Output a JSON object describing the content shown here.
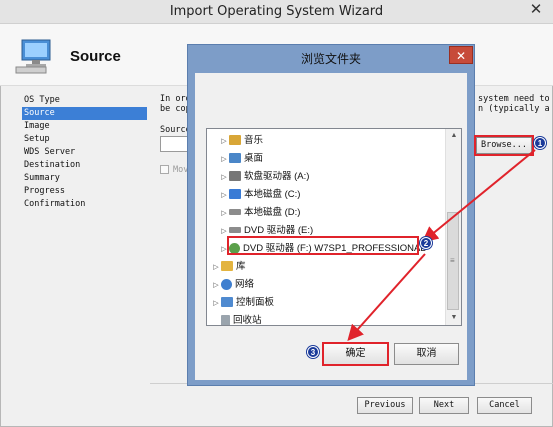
{
  "window": {
    "title": "Import Operating System Wizard",
    "close_glyph": "✕"
  },
  "header": {
    "title": "Source"
  },
  "nav": {
    "items": [
      {
        "label": "OS Type"
      },
      {
        "label": "Source"
      },
      {
        "label": "Image"
      },
      {
        "label": "Setup"
      },
      {
        "label": "WDS Server"
      },
      {
        "label": "Destination"
      },
      {
        "label": "Summary"
      },
      {
        "label": "Progress"
      },
      {
        "label": "Confirmation"
      }
    ],
    "selected_index": 1
  },
  "main": {
    "desc_line1_left": "In ord",
    "desc_line1_right": "system need to",
    "desc_line2_left": "be cop",
    "desc_line2_right": "n (typically a",
    "source_label": "Source",
    "checkbox_label": "Mov",
    "browse_label": "Browse..."
  },
  "footer": {
    "previous": "Previous",
    "next": "Next",
    "cancel": "Cancel"
  },
  "dialog": {
    "title": "浏览文件夹",
    "close_glyph": "✕",
    "ok_label": "确定",
    "cancel_label": "取消",
    "tree": [
      {
        "label": "音乐",
        "icon": "music-folder-icon",
        "color": "#d8a637",
        "level": 1
      },
      {
        "label": "桌面",
        "icon": "desktop-folder-icon",
        "color": "#4a86c8",
        "level": 1
      },
      {
        "label": "软盘驱动器 (A:)",
        "icon": "floppy-drive-icon",
        "color": "#777777",
        "level": 1
      },
      {
        "label": "本地磁盘 (C:)",
        "icon": "windows-drive-icon",
        "color": "#3a7bd5",
        "level": 1
      },
      {
        "label": "本地磁盘 (D:)",
        "icon": "disk-drive-icon",
        "color": "#8c8c8c",
        "level": 1
      },
      {
        "label": "DVD 驱动器 (E:)",
        "icon": "dvd-drive-icon",
        "color": "#8c8c8c",
        "level": 1
      },
      {
        "label": "DVD 驱动器 (F:) W7SP1_PROFESSIONAL",
        "icon": "dvd-disc-icon",
        "color": "#5aa04a",
        "level": 1,
        "selected": true
      },
      {
        "label": "库",
        "icon": "library-icon",
        "color": "#e3b440",
        "level": 0
      },
      {
        "label": "网络",
        "icon": "network-icon",
        "color": "#3f7fcf",
        "level": 0
      },
      {
        "label": "控制面板",
        "icon": "control-panel-icon",
        "color": "#4f8ad0",
        "level": 0
      },
      {
        "label": "回收站",
        "icon": "recycle-bin-icon",
        "color": "#9aa4ad",
        "level": 0
      }
    ]
  },
  "annotations": {
    "badge1": "1",
    "badge2": "2",
    "badge3": "3",
    "color": "#e0232b"
  }
}
